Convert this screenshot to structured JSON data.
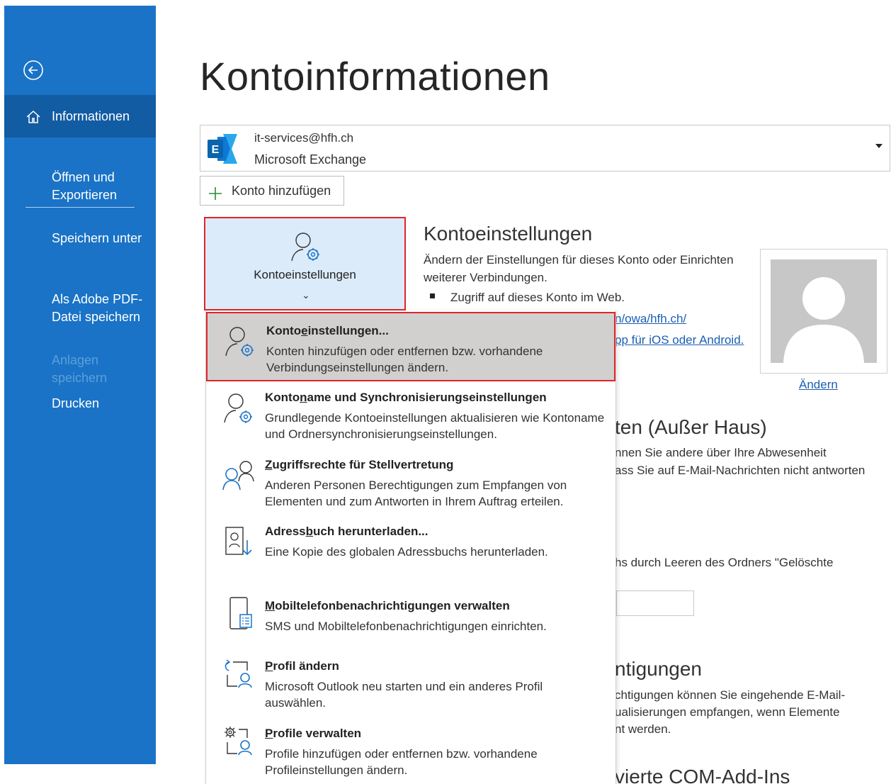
{
  "sidebar": {
    "back_icon": "back-arrow-icon",
    "items": [
      {
        "label": "Informationen",
        "icon": "home-icon",
        "active": true
      },
      {
        "label": "Öffnen und\nExportieren"
      },
      {
        "label": "Speichern unter"
      },
      {
        "label": "Als Adobe PDF-\nDatei speichern"
      },
      {
        "label": "Anlagen\nspeichern",
        "disabled": true
      },
      {
        "label": "Drucken"
      }
    ]
  },
  "page_title": "Kontoinformationen",
  "account": {
    "email": "it-services@hfh.ch",
    "type": "Microsoft Exchange",
    "icon": "exchange-icon"
  },
  "add_account_label": "Konto hinzufügen",
  "settings_tile": {
    "label": "Kontoeinstellungen",
    "chevron": "⌄"
  },
  "kontoeinstellungen": {
    "heading": "Kontoeinstellungen",
    "desc_line1": "Ändern der Einstellungen für dieses Konto oder Einrichten",
    "desc_line2": "weiterer Verbindungen.",
    "bullet1": "Zugriff auf dieses Konto im Web.",
    "link1": "n/owa/hfh.ch/",
    "link2": "pp für iOS oder Android."
  },
  "photo_change_label": "Ändern",
  "autoreply": {
    "heading": "ten (Außer Haus)",
    "line1": "nnen Sie andere über Ihre Abwesenheit",
    "line2": "ass Sie auf E-Mail-Nachrichten nicht antworten"
  },
  "cleanup": {
    "line1": "hs durch Leeren des Ordners \"Gelöschte"
  },
  "notifications": {
    "heading": "ntigungen",
    "line1": "chtigungen können Sie eingehende E-Mail-",
    "line2": "ualisierungen empfangen, wenn Elemente",
    "line3": "nt werden."
  },
  "com_addins": {
    "heading": "vierte COM-Add-Ins"
  },
  "menu": {
    "items": [
      {
        "title_pre": "Konto",
        "title_ul": "e",
        "title_post": "instellungen...",
        "desc": "Konten hinzufügen oder entfernen bzw. vorhandene Verbindungseinstellungen ändern."
      },
      {
        "title_pre": "Konto",
        "title_ul": "n",
        "title_post": "ame und Synchronisierungseinstellungen",
        "desc": "Grundlegende Kontoeinstellungen aktualisieren wie Kontoname und Ordnersynchronisierungseinstellungen."
      },
      {
        "title_pre": "",
        "title_ul": "Z",
        "title_post": "ugriffsrechte für Stellvertretung",
        "desc": "Anderen Personen Berechtigungen zum Empfangen von Elementen und zum Antworten in Ihrem Auftrag erteilen."
      },
      {
        "title_pre": "Adress",
        "title_ul": "b",
        "title_post": "uch herunterladen...",
        "desc": "Eine Kopie des globalen Adressbuchs herunterladen."
      },
      {
        "title_pre": "",
        "title_ul": "M",
        "title_post": "obiltelefonbenachrichtigungen verwalten",
        "desc": "SMS und Mobiltelefonbenachrichtigungen einrichten."
      },
      {
        "title_pre": "",
        "title_ul": "P",
        "title_post": "rofil ändern",
        "desc": "Microsoft Outlook neu starten und ein anderes Profil auswählen."
      },
      {
        "title_pre": "",
        "title_ul": "P",
        "title_post": "rofile verwalten",
        "desc": "Profile hinzufügen oder entfernen bzw. vorhandene Profileinstellungen ändern."
      }
    ]
  }
}
